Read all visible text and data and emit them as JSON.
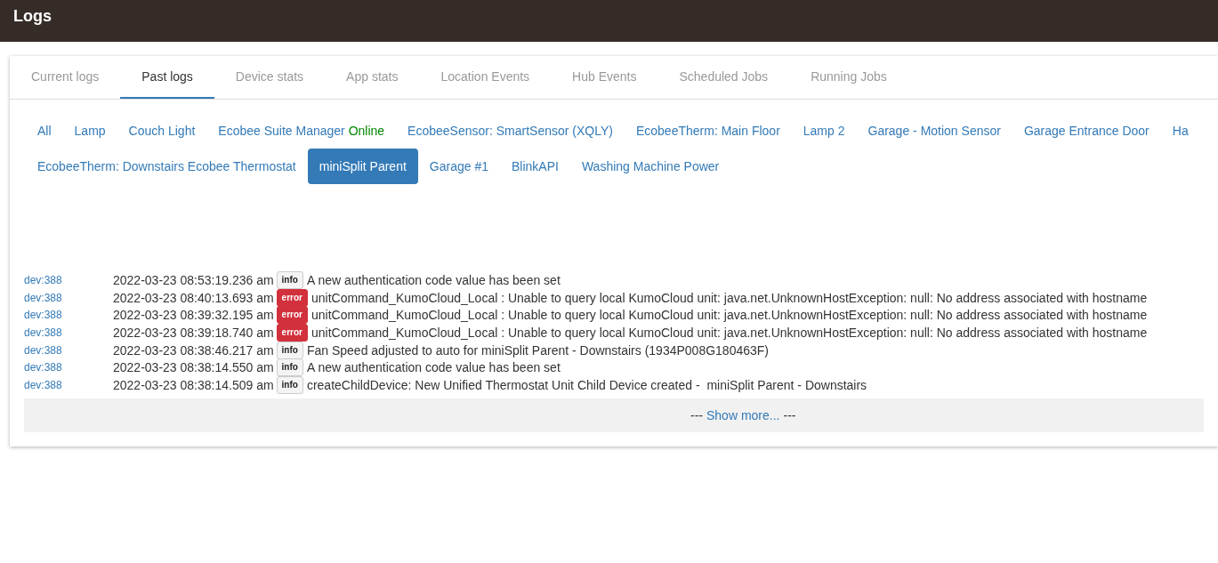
{
  "header": {
    "title": "Logs"
  },
  "tabs": [
    {
      "label": "Current logs",
      "selected": false
    },
    {
      "label": "Past logs",
      "selected": true
    },
    {
      "label": "Device stats",
      "selected": false
    },
    {
      "label": "App stats",
      "selected": false
    },
    {
      "label": "Location Events",
      "selected": false
    },
    {
      "label": "Hub Events",
      "selected": false
    },
    {
      "label": "Scheduled Jobs",
      "selected": false
    },
    {
      "label": "Running Jobs",
      "selected": false
    }
  ],
  "devices": [
    {
      "label": "All",
      "selected": false
    },
    {
      "label": "Lamp",
      "selected": false
    },
    {
      "label": "Couch Light",
      "selected": false
    },
    {
      "label": "Ecobee Suite Manager",
      "status": "Online",
      "selected": false
    },
    {
      "label": "EcobeeSensor: SmartSensor (XQLY)",
      "selected": false
    },
    {
      "label": "EcobeeTherm: Main Floor",
      "selected": false
    },
    {
      "label": "Lamp 2",
      "selected": false
    },
    {
      "label": "Garage - Motion Sensor",
      "selected": false
    },
    {
      "label": "Garage Entrance Door",
      "selected": false
    },
    {
      "label": "Ha",
      "selected": false
    },
    {
      "label": "EcobeeTherm: Downstairs Ecobee Thermostat",
      "selected": false
    },
    {
      "label": "miniSplit Parent",
      "selected": true
    },
    {
      "label": "Garage #1",
      "selected": false
    },
    {
      "label": "BlinkAPI",
      "selected": false
    },
    {
      "label": "Washing Machine Power",
      "selected": false
    }
  ],
  "logs": [
    {
      "source": "dev:388",
      "time": "2022-03-23 08:53:19.236 am",
      "level": "info",
      "message": "A new authentication code value has been set"
    },
    {
      "source": "dev:388",
      "time": "2022-03-23 08:40:13.693 am",
      "level": "error",
      "message": "unitCommand_KumoCloud_Local : Unable to query local KumoCloud unit: java.net.UnknownHostException: null: No address associated with hostname"
    },
    {
      "source": "dev:388",
      "time": "2022-03-23 08:39:32.195 am",
      "level": "error",
      "message": "unitCommand_KumoCloud_Local : Unable to query local KumoCloud unit: java.net.UnknownHostException: null: No address associated with hostname"
    },
    {
      "source": "dev:388",
      "time": "2022-03-23 08:39:18.740 am",
      "level": "error",
      "message": "unitCommand_KumoCloud_Local : Unable to query local KumoCloud unit: java.net.UnknownHostException: null: No address associated with hostname"
    },
    {
      "source": "dev:388",
      "time": "2022-03-23 08:38:46.217 am",
      "level": "info",
      "message": "Fan Speed adjusted to auto for miniSplit Parent - Downstairs (1934P008G180463F)"
    },
    {
      "source": "dev:388",
      "time": "2022-03-23 08:38:14.550 am",
      "level": "info",
      "message": "A new authentication code value has been set"
    },
    {
      "source": "dev:388",
      "time": "2022-03-23 08:38:14.509 am",
      "level": "info",
      "message": "createChildDevice: New Unified Thermostat Unit Child Device created -  miniSplit Parent - Downstairs"
    }
  ],
  "show_more": {
    "prefix": "---",
    "link": "Show more...",
    "suffix": "---"
  }
}
